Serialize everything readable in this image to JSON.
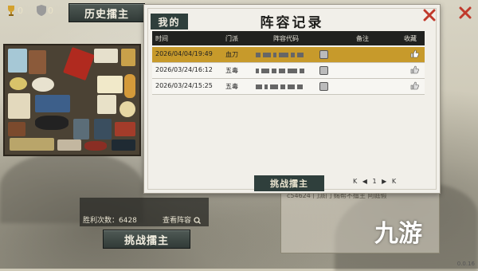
{
  "resources": [
    {
      "icon": "trophy-icon",
      "value": "0"
    },
    {
      "icon": "shield-icon",
      "value": "0"
    }
  ],
  "history_button_label": "历史擂主",
  "stats": {
    "player_name": "",
    "wins_label": "胜利次数：6428",
    "view_lineup_label": "查看阵容"
  },
  "challenge_bottom_label": "挑战擂主",
  "side_panel_text": "c54624 门派门 赐帮不擂主 阿庭假",
  "dialog": {
    "tab_label": "我的",
    "title": "阵容记录",
    "columns": [
      "时间",
      "门派",
      "阵容代码",
      "备注",
      "收藏"
    ],
    "rows": [
      {
        "time": "2026/04/04/19:49",
        "sect": "血刀",
        "selected": true
      },
      {
        "time": "2026/03/24/16:12",
        "sect": "五毒",
        "selected": false
      },
      {
        "time": "2026/03/24/15:25",
        "sect": "五毒",
        "selected": false
      }
    ],
    "challenge_label": "挑战擂主",
    "pager": {
      "first": "K",
      "prev": "◀",
      "page": "1",
      "next": "▶",
      "last": "K"
    }
  },
  "watermark": "九游",
  "version": "0.0.16",
  "colors": {
    "selected_row": "#c79a2b",
    "dark_button": "#2f3f3c",
    "close_red": "#c0392b"
  }
}
